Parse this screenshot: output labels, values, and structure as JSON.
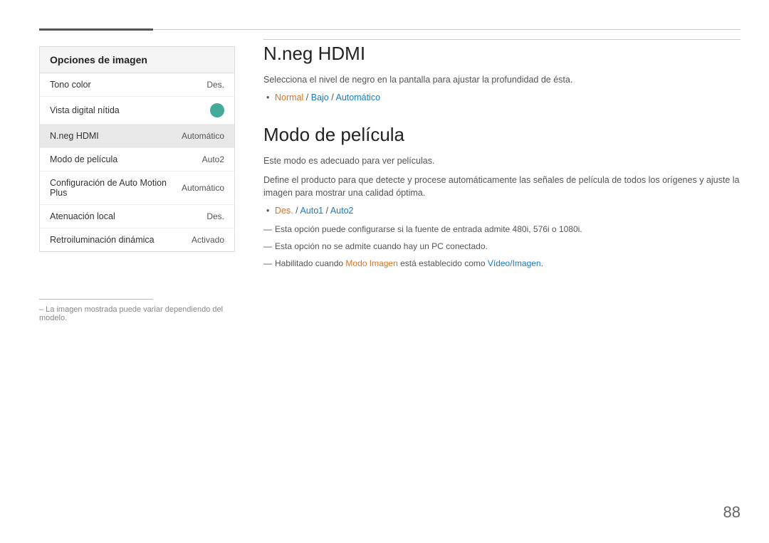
{
  "top_lines": {},
  "left_panel": {
    "title": "Opciones de imagen",
    "items": [
      {
        "label": "Tono color",
        "value": "Des.",
        "type": "text",
        "active": false
      },
      {
        "label": "Vista digital nítida",
        "value": "",
        "type": "toggle",
        "active": false
      },
      {
        "label": "N.neg HDMI",
        "value": "Automático",
        "type": "text",
        "active": true
      },
      {
        "label": "Modo de película",
        "value": "Auto2",
        "type": "text",
        "active": false
      },
      {
        "label": "Configuración de Auto Motion Plus",
        "value": "Automático",
        "type": "text",
        "active": false
      },
      {
        "label": "Atenuación local",
        "value": "Des.",
        "type": "text",
        "active": false
      },
      {
        "label": "Retroiluminación dinámica",
        "value": "Activado",
        "type": "text",
        "active": false
      }
    ]
  },
  "footnote": "– La imagen mostrada puede variar dependiendo del modelo.",
  "section1": {
    "title": "N.neg HDMI",
    "desc": "Selecciona el nivel de negro en la pantalla para ajustar la profundidad de ésta.",
    "options_label": "Normal / Bajo / Automático",
    "options": [
      {
        "text": "Normal",
        "color": "orange"
      },
      {
        "separator": " / "
      },
      {
        "text": "Bajo",
        "color": "blue"
      },
      {
        "separator": " / "
      },
      {
        "text": "Automático",
        "color": "blue"
      }
    ]
  },
  "section2": {
    "title": "Modo de película",
    "desc1": "Este modo es adecuado para ver películas.",
    "desc2": "Define el producto para que detecte y procese automáticamente las señales de película de todos los orígenes y ajuste la imagen para mostrar una calidad óptima.",
    "options": [
      {
        "text": "Des.",
        "color": "orange"
      },
      {
        "separator": " / "
      },
      {
        "text": "Auto1",
        "color": "blue"
      },
      {
        "separator": " / "
      },
      {
        "text": "Auto2",
        "color": "blue"
      }
    ],
    "notes": [
      "Esta opción puede configurarse si la fuente de entrada admite 480i, 576i o 1080i.",
      "Esta opción no se admite cuando hay un PC conectado.",
      "Habilitado cuando Modo Imagen está establecido como Vídeo/Imagen."
    ],
    "note3_parts": {
      "prefix": "Habilitado cuando ",
      "link1": "Modo Imagen",
      "middle": " está establecido como ",
      "link2": "Vídeo/Imagen",
      "suffix": "."
    }
  },
  "page_number": "88"
}
